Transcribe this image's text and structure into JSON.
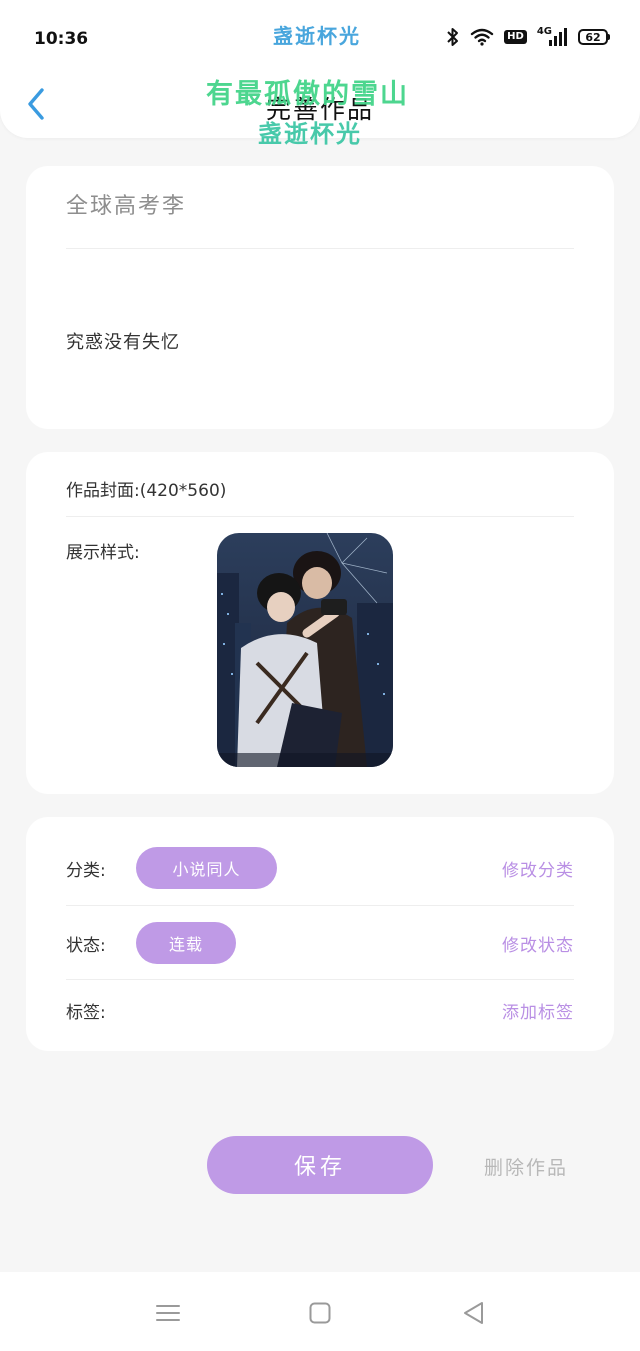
{
  "status_bar": {
    "time": "10:36",
    "network": "4G",
    "hd": "HD",
    "battery": "62",
    "icons": [
      "bluetooth-icon",
      "wifi-icon",
      "hd-icon",
      "signal-icon",
      "battery-icon"
    ]
  },
  "watermark": {
    "top": "盏逝杯光",
    "middle": "有最孤傲的雪山",
    "bottom": "盏逝杯光"
  },
  "header": {
    "title": "完善作品",
    "back_icon": "chevron-left-icon"
  },
  "work": {
    "title": "全球高考李",
    "summary": "究惑没有失忆"
  },
  "cover": {
    "label": "作品封面:(420*560)",
    "style_label": "展示样式:"
  },
  "meta": {
    "category_label": "分类:",
    "category_value": "小说同人",
    "category_action": "修改分类",
    "status_label": "状态:",
    "status_value": "连载",
    "status_action": "修改状态",
    "tags_label": "标签:",
    "tags_action": "添加标签"
  },
  "actions": {
    "save": "保存",
    "delete": "删除作品"
  },
  "navbar": {
    "icons": [
      "menu-icon",
      "home-icon",
      "back-triangle-icon"
    ]
  },
  "colors": {
    "accent": "#bf9ae6",
    "accent_text": "#b98fe4",
    "back_arrow": "#3a9be0",
    "background": "#f6f6f6"
  }
}
